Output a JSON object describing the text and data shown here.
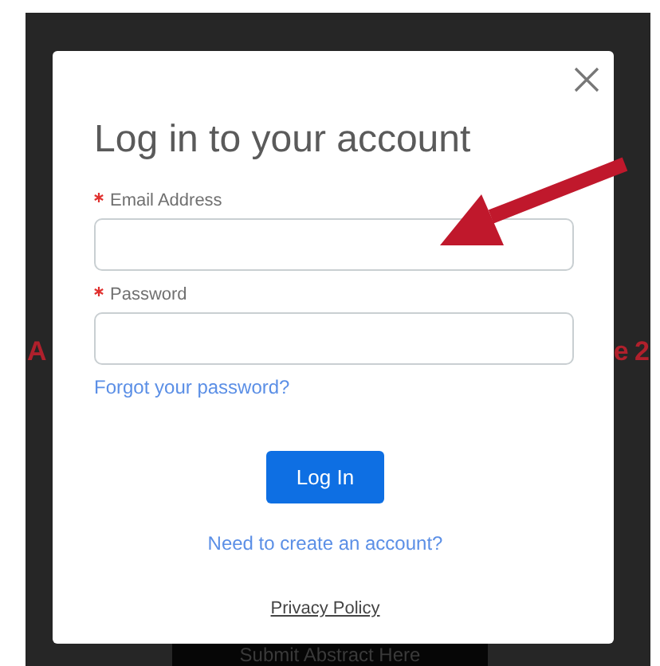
{
  "background": {
    "heading_fragments": [
      "A",
      "e 2"
    ],
    "submit_button": "Submit Abstract Here"
  },
  "modal": {
    "title": "Log in to your account",
    "fields": [
      {
        "label": "Email Address",
        "required": true
      },
      {
        "label": "Password",
        "required": true
      }
    ],
    "forgot_link": "Forgot your password?",
    "login_button": "Log In",
    "signup_link": "Need to create an account?",
    "privacy_link": "Privacy Policy"
  }
}
